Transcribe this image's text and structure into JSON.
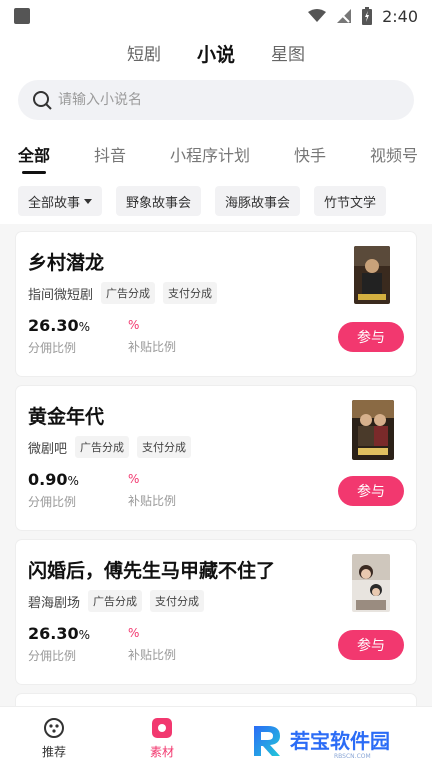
{
  "status": {
    "time": "2:40"
  },
  "top_tabs": [
    {
      "label": "短剧",
      "active": false
    },
    {
      "label": "小说",
      "active": true
    },
    {
      "label": "星图",
      "active": false
    }
  ],
  "search": {
    "placeholder": "请输入小说名",
    "value": ""
  },
  "categories": [
    "全部",
    "抖音",
    "小程序计划",
    "快手",
    "视频号"
  ],
  "filters": [
    "全部故事",
    "野象故事会",
    "海豚故事会",
    "竹节文学"
  ],
  "cards": [
    {
      "title": "乡村潜龙",
      "source": "指间微短剧",
      "tags": [
        "广告分成",
        "支付分成"
      ],
      "rate_value": "26.30",
      "rate_unit": "%",
      "rate_label": "分佣比例",
      "subsidy_unit": "%",
      "subsidy_label": "补贴比例",
      "join_label": "参与"
    },
    {
      "title": "黄金年代",
      "source": "微剧吧",
      "tags": [
        "广告分成",
        "支付分成"
      ],
      "rate_value": "0.90",
      "rate_unit": "%",
      "rate_label": "分佣比例",
      "subsidy_unit": "%",
      "subsidy_label": "补贴比例",
      "join_label": "参与"
    },
    {
      "title": "闪婚后，傅先生马甲藏不住了",
      "source": "碧海剧场",
      "tags": [
        "广告分成",
        "支付分成"
      ],
      "rate_value": "26.30",
      "rate_unit": "%",
      "rate_label": "分佣比例",
      "subsidy_unit": "%",
      "subsidy_label": "补贴比例",
      "join_label": "参与"
    }
  ],
  "bottom_nav": [
    {
      "label": "推荐",
      "icon": "recommend-icon"
    },
    {
      "label": "素材",
      "icon": "material-icon"
    }
  ],
  "watermark": {
    "text": "若宝软件园",
    "subtext": "RBSCN.COM"
  },
  "colors": {
    "accent": "#f2386f"
  }
}
